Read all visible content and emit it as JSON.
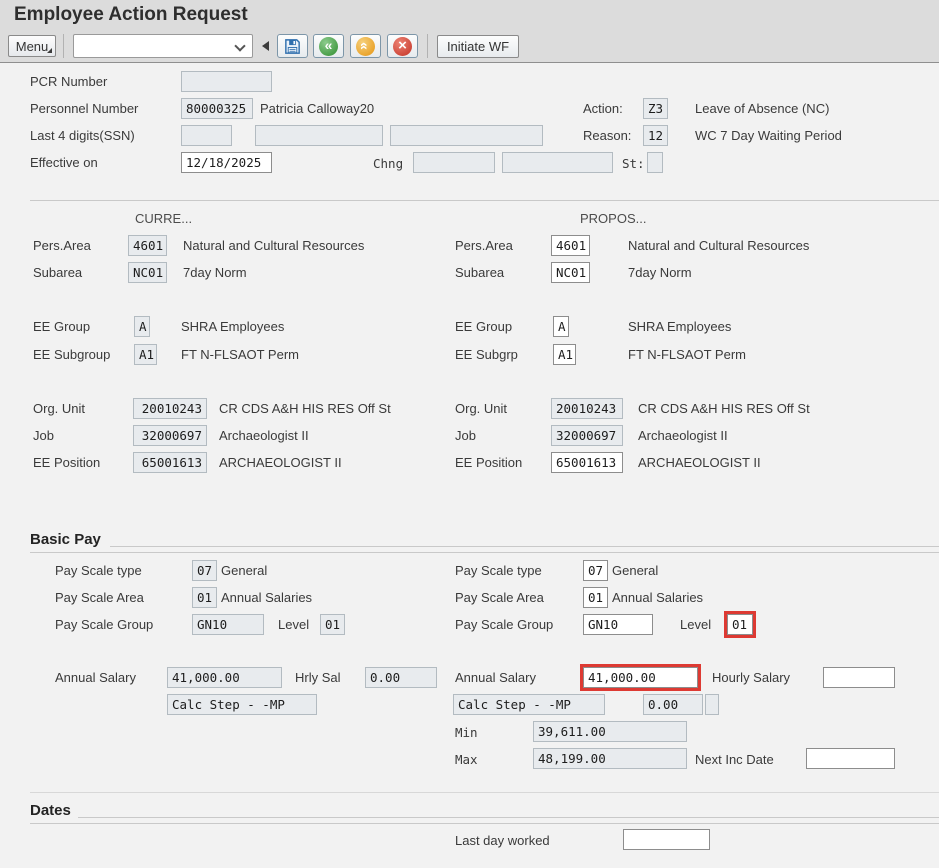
{
  "colors": {
    "highlight_red": "#dd3a33",
    "titlebar_bg": "#dcdcdc",
    "body_bg": "#f2f2f2",
    "save_icon_blue": "#2f6fae",
    "back_icon_green": "#2e8d2e",
    "exit_icon_orange": "#e59410",
    "cancel_icon_red": "#c23226"
  },
  "header": {
    "title": "Employee Action Request"
  },
  "toolbar": {
    "menu_label": "Menu",
    "combobox_value": "",
    "icons": {
      "save": "save-icon",
      "back": "back-icon",
      "exit": "exit-up-icon",
      "cancel": "cancel-icon"
    },
    "initiate_wf_label": "Initiate WF"
  },
  "request": {
    "pcr_number_label": "PCR Number",
    "pcr_number_value": "",
    "personnel_number_label": "Personnel Number",
    "personnel_number_value": "80000325",
    "personnel_name": "Patricia Calloway20",
    "ssn_label": "Last 4 digits(SSN)",
    "effective_on_label": "Effective on",
    "effective_on_value": "12/18/2025",
    "chng_label": "Chng",
    "st_label": "St:",
    "action_label": "Action:",
    "action_code": "Z3",
    "action_text": "Leave of Absence (NC)",
    "reason_label": "Reason:",
    "reason_code": "12",
    "reason_text": "WC 7 Day Waiting Period"
  },
  "current": {
    "header": "CURRE...",
    "pers_area_label": "Pers.Area",
    "pers_area_code": "4601",
    "pers_area_text": "Natural and Cultural Resources",
    "subarea_label": "Subarea",
    "subarea_code": "NC01",
    "subarea_text": "7day Norm",
    "ee_group_label": "EE Group",
    "ee_group_code": "A",
    "ee_group_text": "SHRA Employees",
    "ee_subgroup_label": "EE Subgroup",
    "ee_subgroup_code": "A1",
    "ee_subgroup_text": "FT N-FLSAOT Perm",
    "org_unit_label": "Org. Unit",
    "org_unit_code": "20010243",
    "org_unit_text": "CR CDS A&H HIS RES Off St",
    "job_label": "Job",
    "job_code": "32000697",
    "job_text": "Archaeologist II",
    "ee_position_label": "EE Position",
    "ee_position_code": "65001613",
    "ee_position_text": "ARCHAEOLOGIST II"
  },
  "proposed": {
    "header": "PROPOS...",
    "pers_area_label": "Pers.Area",
    "pers_area_code": "4601",
    "pers_area_text": "Natural and Cultural Resources",
    "subarea_label": "Subarea",
    "subarea_code": "NC01",
    "subarea_text": "7day Norm",
    "ee_group_label": "EE Group",
    "ee_group_code": "A",
    "ee_group_text": "SHRA Employees",
    "ee_subgroup_label": "EE Subgrp",
    "ee_subgroup_code": "A1",
    "ee_subgroup_text": "FT N-FLSAOT Perm",
    "org_unit_label": "Org. Unit",
    "org_unit_code": "20010243",
    "org_unit_text": "CR CDS A&H HIS RES Off St",
    "job_label": "Job",
    "job_code": "32000697",
    "job_text": "Archaeologist II",
    "ee_position_label": "EE Position",
    "ee_position_code": "65001613",
    "ee_position_text": "ARCHAEOLOGIST II"
  },
  "basic_pay": {
    "heading": "Basic Pay",
    "current": {
      "pay_scale_type_label": "Pay Scale type",
      "pay_scale_type_code": "07",
      "pay_scale_type_text": "General",
      "pay_scale_area_label": "Pay Scale Area",
      "pay_scale_area_code": "01",
      "pay_scale_area_text": "Annual Salaries",
      "pay_scale_group_label": "Pay Scale Group",
      "pay_scale_group_value": "GN10",
      "level_label": "Level",
      "level_value": "01",
      "annual_salary_label": "Annual Salary",
      "annual_salary_value": "41,000.00",
      "hourly_salary_label": "Hrly Sal",
      "hourly_salary_value": "0.00",
      "calc_step_value": "Calc Step - -MP"
    },
    "proposed": {
      "pay_scale_type_label": "Pay Scale type",
      "pay_scale_type_code": "07",
      "pay_scale_type_text": "General",
      "pay_scale_area_label": "Pay Scale Area",
      "pay_scale_area_code": "01",
      "pay_scale_area_text": "Annual Salaries",
      "pay_scale_group_label": "Pay Scale Group",
      "pay_scale_group_value": "GN10",
      "level_label": "Level",
      "level_value": "01",
      "annual_salary_label": "Annual Salary",
      "annual_salary_value": "41,000.00",
      "hourly_salary_label": "Hourly Salary",
      "hourly_salary_value": "",
      "calc_step_value": "Calc Step - -MP",
      "calc_step_amount": "0.00",
      "min_label": "Min",
      "min_value": "39,611.00",
      "max_label": "Max",
      "max_value": "48,199.00",
      "next_inc_date_label": "Next Inc Date",
      "next_inc_date_value": ""
    }
  },
  "dates": {
    "heading": "Dates",
    "last_day_worked_label": "Last day worked",
    "last_day_worked_value": ""
  }
}
